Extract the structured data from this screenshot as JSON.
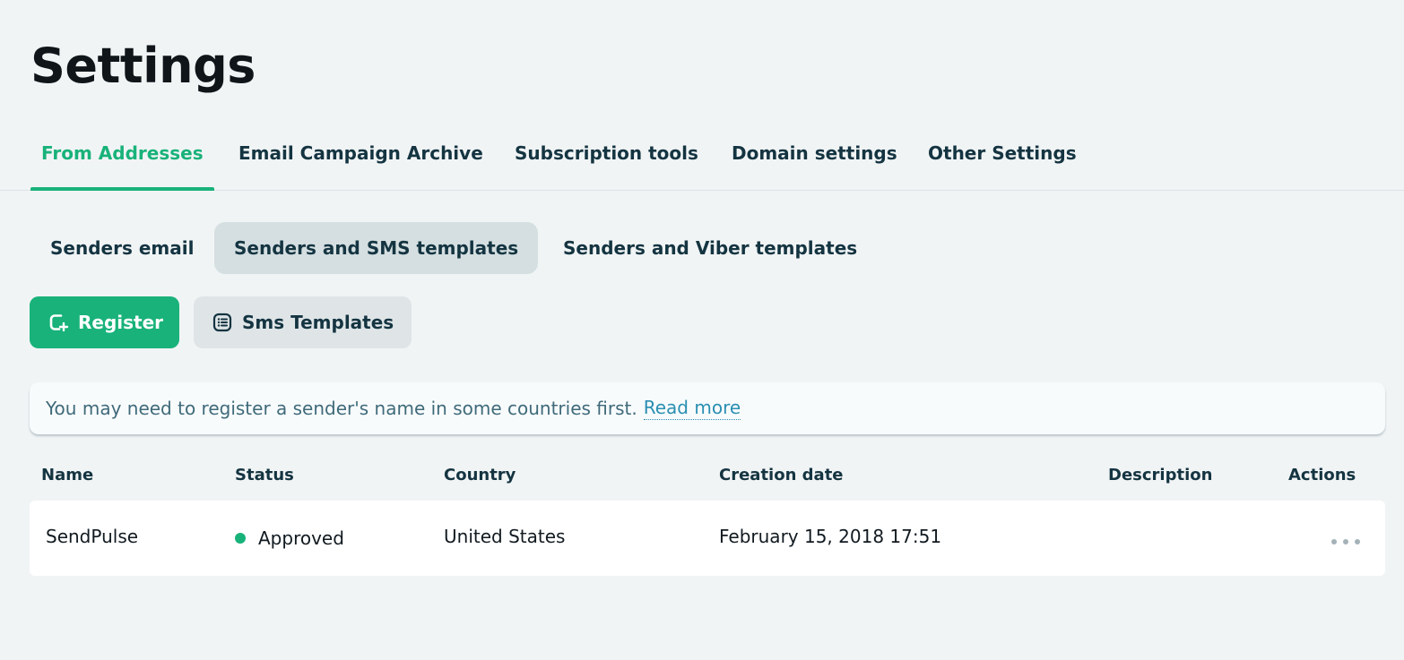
{
  "page": {
    "title": "Settings"
  },
  "tabs": [
    {
      "label": "From Addresses",
      "active": true
    },
    {
      "label": "Email Campaign Archive",
      "active": false
    },
    {
      "label": "Subscription tools",
      "active": false
    },
    {
      "label": "Domain settings",
      "active": false
    },
    {
      "label": "Other Settings",
      "active": false
    }
  ],
  "subtabs": [
    {
      "label": "Senders email",
      "active": false
    },
    {
      "label": "Senders and SMS templates",
      "active": true
    },
    {
      "label": "Senders and Viber templates",
      "active": false
    }
  ],
  "actions": {
    "register_label": "Register",
    "register_icon": "register-sender-icon",
    "sms_templates_label": "Sms Templates",
    "sms_templates_icon": "list-icon"
  },
  "notice": {
    "text": "You may need to register a sender's name in some countries first.",
    "link": "Read more"
  },
  "table": {
    "headers": [
      "Name",
      "Status",
      "Country",
      "Creation date",
      "Description",
      "Actions"
    ],
    "rows": [
      {
        "name": "SendPulse",
        "status": "Approved",
        "country": "United States",
        "created": "February 15, 2018 17:51",
        "description": ""
      }
    ]
  },
  "colors": {
    "accent": "#18b27a",
    "background": "#f1f4f5",
    "text": "#143441",
    "link": "#2a8fb2"
  }
}
